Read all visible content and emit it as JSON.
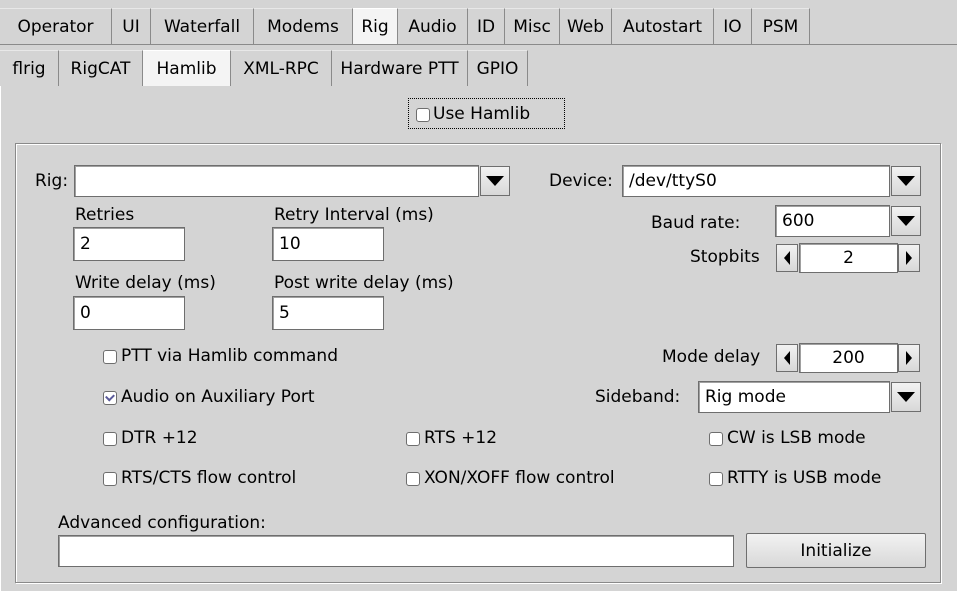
{
  "tabs_main": [
    "Operator",
    "UI",
    "Waterfall",
    "Modems",
    "Rig",
    "Audio",
    "ID",
    "Misc",
    "Web",
    "Autostart",
    "IO",
    "PSM"
  ],
  "tabs_rig": [
    "flrig",
    "RigCAT",
    "Hamlib",
    "XML-RPC",
    "Hardware PTT",
    "GPIO"
  ],
  "use_hamlib": {
    "label": "Use Hamlib",
    "checked": false
  },
  "rig": {
    "label": "Rig:",
    "value": ""
  },
  "device": {
    "label": "Device:",
    "value": "/dev/ttyS0"
  },
  "baud": {
    "label": "Baud rate:",
    "value": "600"
  },
  "stopbits": {
    "label": "Stopbits",
    "value": "2"
  },
  "retries": {
    "label": "Retries",
    "value": "2"
  },
  "retry_interval": {
    "label": "Retry Interval (ms)",
    "value": "10"
  },
  "write_delay": {
    "label": "Write delay (ms)",
    "value": "0"
  },
  "post_write_delay": {
    "label": "Post write delay (ms)",
    "value": "5"
  },
  "mode_delay": {
    "label": "Mode delay",
    "value": "200"
  },
  "sideband": {
    "label": "Sideband:",
    "value": "Rig mode"
  },
  "checks": {
    "ptt_hamlib": {
      "label": "PTT via Hamlib command",
      "checked": false
    },
    "audio_aux": {
      "label": "Audio on Auxiliary Port",
      "checked": true
    },
    "dtr": {
      "label": "DTR +12",
      "checked": false
    },
    "rts": {
      "label": "RTS +12",
      "checked": false
    },
    "cw_lsb": {
      "label": "CW is LSB mode",
      "checked": false
    },
    "rts_cts": {
      "label": "RTS/CTS flow control",
      "checked": false
    },
    "xon_xoff": {
      "label": "XON/XOFF flow control",
      "checked": false
    },
    "rtty_usb": {
      "label": "RTTY is USB mode",
      "checked": false
    }
  },
  "advanced": {
    "label": "Advanced configuration:",
    "value": ""
  },
  "initialize_label": "Initialize"
}
